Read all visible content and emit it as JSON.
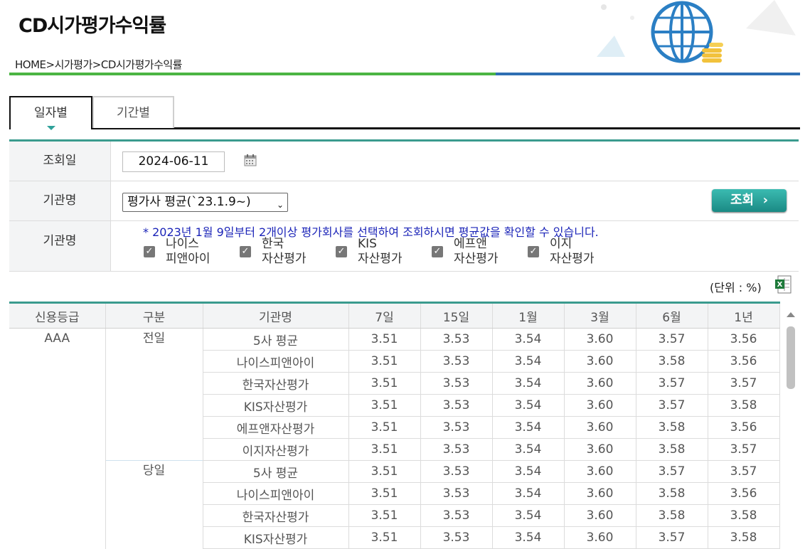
{
  "page": {
    "title": "CD시가평가수익률",
    "breadcrumb": "HOME>시가평가>CD시가평가수익률"
  },
  "tabs": [
    {
      "label": "일자별",
      "active": true
    },
    {
      "label": "기간별",
      "active": false
    }
  ],
  "form": {
    "date_label": "조회일",
    "date_value": "2024-06-11",
    "agency_label": "기관명",
    "agency_select": "평가사 평균(`23.1.9~)",
    "search_button": "조회",
    "agencies_label": "기관명",
    "notice": "* 2023년 1월 9일부터 2개이상 평가회사를 선택하여 조회하시면 평균값을 확인할 수 있습니다.",
    "checkboxes": [
      {
        "line1": "나이스",
        "line2": "피앤아이",
        "checked": true
      },
      {
        "line1": "한국",
        "line2": "자산평가",
        "checked": true
      },
      {
        "line1": "KIS",
        "line2": "자산평가",
        "checked": true
      },
      {
        "line1": "에프앤",
        "line2": "자산평가",
        "checked": true
      },
      {
        "line1": "이지",
        "line2": "자산평가",
        "checked": true
      }
    ]
  },
  "unit_text": "(단위 : %)",
  "table": {
    "headers": [
      "신용등급",
      "구분",
      "기관명",
      "7일",
      "15일",
      "1월",
      "3월",
      "6월",
      "1년"
    ],
    "grade": "AAA",
    "groups": [
      {
        "label": "전일",
        "rows": [
          [
            "5사 평균",
            "3.51",
            "3.53",
            "3.54",
            "3.60",
            "3.57",
            "3.56"
          ],
          [
            "나이스피앤아이",
            "3.51",
            "3.53",
            "3.54",
            "3.60",
            "3.58",
            "3.56"
          ],
          [
            "한국자산평가",
            "3.51",
            "3.53",
            "3.54",
            "3.60",
            "3.57",
            "3.57"
          ],
          [
            "KIS자산평가",
            "3.51",
            "3.53",
            "3.54",
            "3.60",
            "3.57",
            "3.58"
          ],
          [
            "에프앤자산평가",
            "3.51",
            "3.53",
            "3.54",
            "3.60",
            "3.58",
            "3.56"
          ],
          [
            "이지자산평가",
            "3.51",
            "3.53",
            "3.54",
            "3.60",
            "3.58",
            "3.57"
          ]
        ]
      },
      {
        "label": "당일",
        "rows": [
          [
            "5사 평균",
            "3.51",
            "3.53",
            "3.54",
            "3.60",
            "3.57",
            "3.57"
          ],
          [
            "나이스피앤아이",
            "3.51",
            "3.53",
            "3.54",
            "3.60",
            "3.58",
            "3.56"
          ],
          [
            "한국자산평가",
            "3.51",
            "3.53",
            "3.54",
            "3.60",
            "3.58",
            "3.58"
          ],
          [
            "KIS자산평가",
            "3.51",
            "3.53",
            "3.54",
            "3.60",
            "3.57",
            "3.58"
          ]
        ]
      }
    ]
  },
  "colors": {
    "accent_teal": "#3a9b8e",
    "line_green": "#4bb543",
    "line_blue": "#2e6fb3",
    "notice_blue": "#1b24b8"
  }
}
